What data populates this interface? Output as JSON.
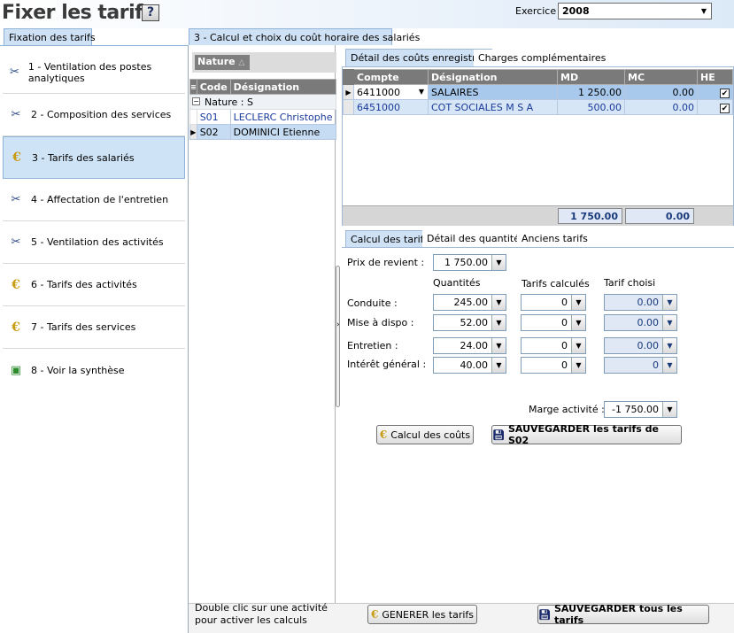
{
  "header": {
    "title": "Fixer les tarifs",
    "help_label": "?",
    "exercice_label": "Exercice",
    "exercice_value": "2008"
  },
  "left": {
    "tab": "Fixation des tarifs",
    "items": [
      {
        "label": "1 - Ventilation des postes analytiques",
        "icon": "scissors-icon"
      },
      {
        "label": "2 - Composition des services",
        "icon": "scissors-icon"
      },
      {
        "label": "3 - Tarifs des salariés",
        "icon": "euro-icon"
      },
      {
        "label": "4 - Affectation de l'entretien",
        "icon": "scissors-icon"
      },
      {
        "label": "5 - Ventilation des activités",
        "icon": "scissors-icon"
      },
      {
        "label": "6 - Tarifs des activités",
        "icon": "euro-icon"
      },
      {
        "label": "7 - Tarifs des services",
        "icon": "euro-icon"
      },
      {
        "label": "8 - Voir la synthèse",
        "icon": "document-check-icon"
      }
    ]
  },
  "middle": {
    "tab": "3 - Calcul et choix du coût horaire des salariés",
    "group_button": "Nature",
    "columns": [
      "Code",
      "Désignation"
    ],
    "group_row": "Nature : S",
    "rows": [
      {
        "code": "S01",
        "designation": "LECLERC Christophe"
      },
      {
        "code": "S02",
        "designation": "DOMINICI Etienne"
      }
    ]
  },
  "detail": {
    "tabs": [
      "Détail des coûts enregistrés",
      "Charges complémentaires"
    ],
    "columns": [
      "Compte",
      "Désignation",
      "MD",
      "MC",
      "HE"
    ],
    "rows": [
      {
        "compte": "6411000",
        "designation": "SALAIRES",
        "md": "1 250.00",
        "mc": "0.00",
        "he": "✔"
      },
      {
        "compte": "6451000",
        "designation": "COT SOCIALES M S A",
        "md": "500.00",
        "mc": "0.00",
        "he": "✔"
      }
    ],
    "total_md": "1 750.00",
    "total_mc": "0.00"
  },
  "calc": {
    "tabs": [
      "Calcul des tarifs",
      "Détail des quantités",
      "Anciens tarifs"
    ],
    "prix_label": "Prix de revient :",
    "prix_value": "1 750.00",
    "col_quantites": "Quantités",
    "col_tarifs_calcules": "Tarifs calculés",
    "col_tarif_choisi": "Tarif choisi",
    "rows": [
      {
        "label": "Conduite :",
        "qte": "245.00",
        "calc": "0",
        "choisi": "0.00"
      },
      {
        "label": "Mise à dispo :",
        "qte": "52.00",
        "calc": "0",
        "choisi": "0.00"
      },
      {
        "label": "Entretien :",
        "qte": "24.00",
        "calc": "0",
        "choisi": "0.00"
      },
      {
        "label": "Intérêt général :",
        "qte": "40.00",
        "calc": "0",
        "choisi": "0"
      }
    ],
    "marge_label": "Marge activité :",
    "marge_value": "-1 750.00",
    "btn_calcul": "Calcul des coûts",
    "btn_save": "SAUVEGARDER les tarifs de S02"
  },
  "bottom": {
    "hint_line1": "Double clic sur une activité",
    "hint_line2": "pour activer les calculs",
    "btn_generer": "GENERER les tarifs",
    "btn_save_all": "SAUVEGARDER tous les tarifs"
  },
  "colors": {
    "accent_blue": "#cfe1f5",
    "selected_row": "#a8c8ec",
    "grid_header": "#7a7a7a"
  }
}
